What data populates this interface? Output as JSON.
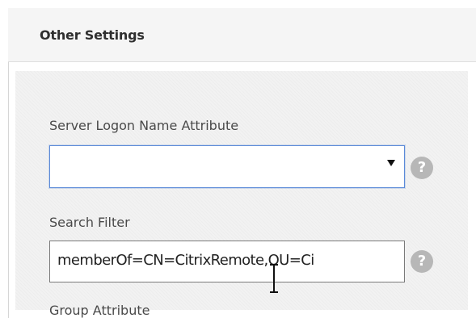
{
  "section": {
    "title": "Other Settings"
  },
  "fields": {
    "server_logon_name_attribute": {
      "label": "Server Logon Name Attribute",
      "value": ""
    },
    "search_filter": {
      "label": "Search Filter",
      "value": "memberOf=CN=CitrixRemote,OU=Ci"
    },
    "group_attribute": {
      "label": "Group Attribute"
    }
  },
  "icons": {
    "help": "?",
    "help_icon_name": "question-circle-icon",
    "dropdown_arrow": "triangle-down-icon",
    "cursor": "text-cursor-icon"
  },
  "colors": {
    "focus_border": "#5b8ad8",
    "help_icon_bg": "#b7b7b7"
  }
}
